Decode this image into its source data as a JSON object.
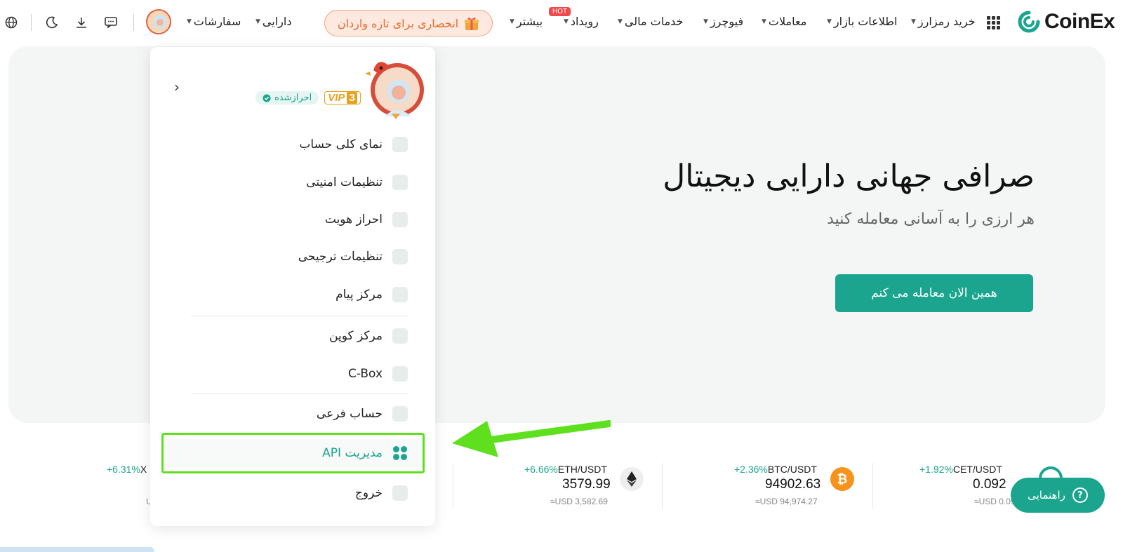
{
  "header": {
    "brand": "CoinEx",
    "nav": [
      {
        "label": "خرید رمزارز",
        "caret": true
      },
      {
        "label": "اطلاعات بازار",
        "caret": true
      },
      {
        "label": "معاملات",
        "caret": true
      },
      {
        "label": "فیوچرز",
        "caret": true
      },
      {
        "label": "خدمات مالی",
        "caret": true
      },
      {
        "label": "رویداد",
        "caret": true
      },
      {
        "label": "بیشتر",
        "caret": true
      }
    ],
    "hot_badge": "HOT",
    "promo": "انحصاری برای تازه واردان",
    "assets": "دارایی",
    "orders": "سفارشات",
    "icons": [
      "chat-icon",
      "download-icon",
      "moon-icon",
      "globe-icon"
    ]
  },
  "hero": {
    "title": "صرافی جهانی دارایی دیجیتال",
    "subtitle": "هر ارزی را به آسانی معامله کنید",
    "cta": "همین الان معامله می کنم"
  },
  "tickers": [
    {
      "pair": "CET/USDT",
      "change": "+1.92%",
      "price": "0.092",
      "usd": "≈USD 0.09"
    },
    {
      "pair": "BTC/USDT",
      "change": "+2.36%",
      "price": "94902.63",
      "usd": "≈USD 94,974.27"
    },
    {
      "pair": "ETH/USDT",
      "change": "+6.66%",
      "price": "3579.99",
      "usd": "≈USD 3,582.69"
    },
    {
      "pair": "X",
      "change": "+6.31%",
      "price": "",
      "usd": "U"
    }
  ],
  "guide": "راهنمایی",
  "account_menu": {
    "verified": "احرازشده",
    "vip": "VIP",
    "vip_level": "3",
    "items": [
      {
        "label": "نمای کلی حساب",
        "icon": "pie-chart-icon"
      },
      {
        "label": "تنظیمات امنیتی",
        "icon": "shield-icon"
      },
      {
        "label": "احراز هویت",
        "icon": "id-card-icon"
      },
      {
        "label": "تنظیمات ترجیحی",
        "icon": "settings-icon"
      },
      {
        "label": "مرکز پیام",
        "icon": "message-icon"
      },
      {
        "label": "مرکز کوپن",
        "icon": "coupon-icon"
      },
      {
        "label": "C-Box",
        "icon": "box-icon"
      },
      {
        "label": "حساب فرعی",
        "icon": "sub-account-icon"
      },
      {
        "label": "مدیریت API",
        "icon": "api-icon"
      },
      {
        "label": "خروج",
        "icon": "logout-icon"
      }
    ]
  },
  "colors": {
    "accent": "#1ba58e",
    "highlight": "#5ee01f",
    "promo": "#e86a2a"
  }
}
